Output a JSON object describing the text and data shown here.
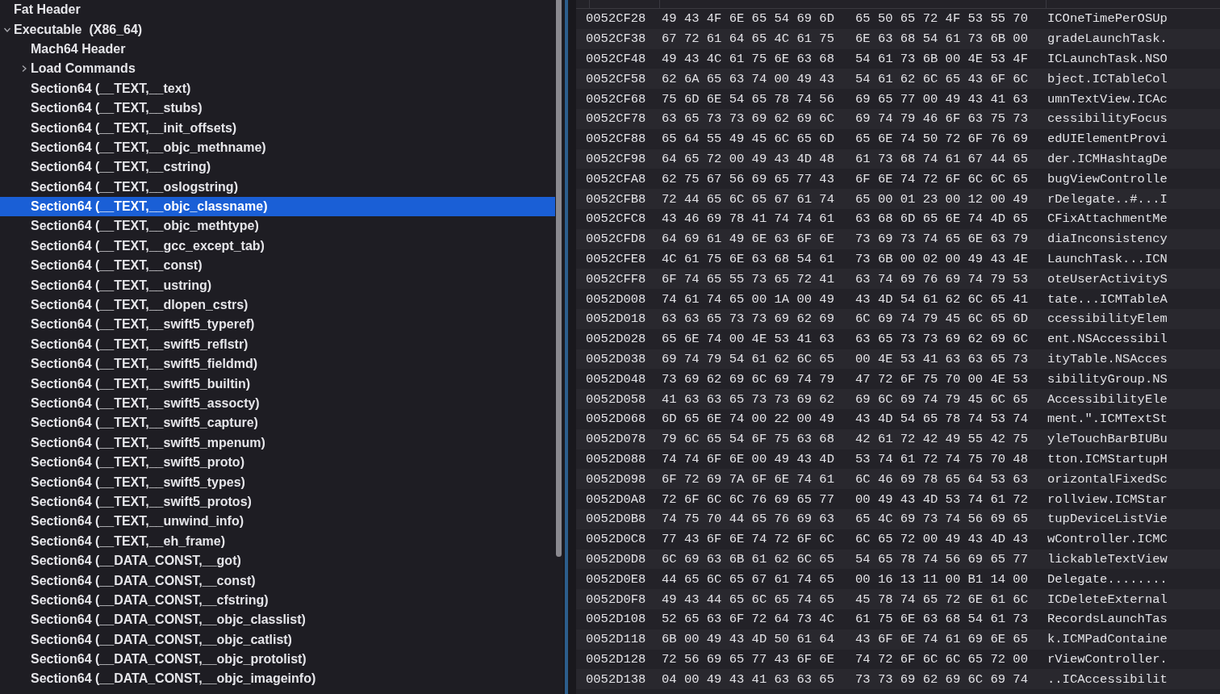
{
  "tree": [
    {
      "label": "Fat Header",
      "selected": false
    },
    {
      "label": "Executable  (X86_64)",
      "expanded": true,
      "selected": false,
      "children": [
        {
          "label": "Mach64 Header",
          "selected": false
        },
        {
          "label": "Load Commands",
          "expanded": false,
          "selected": false
        },
        {
          "label": "Section64 (__TEXT,__text)",
          "selected": false
        },
        {
          "label": "Section64 (__TEXT,__stubs)",
          "selected": false
        },
        {
          "label": "Section64 (__TEXT,__init_offsets)",
          "selected": false
        },
        {
          "label": "Section64 (__TEXT,__objc_methname)",
          "selected": false
        },
        {
          "label": "Section64 (__TEXT,__cstring)",
          "selected": false
        },
        {
          "label": "Section64 (__TEXT,__oslogstring)",
          "selected": false
        },
        {
          "label": "Section64 (__TEXT,__objc_classname)",
          "selected": true
        },
        {
          "label": "Section64 (__TEXT,__objc_methtype)",
          "selected": false
        },
        {
          "label": "Section64 (__TEXT,__gcc_except_tab)",
          "selected": false
        },
        {
          "label": "Section64 (__TEXT,__const)",
          "selected": false
        },
        {
          "label": "Section64 (__TEXT,__ustring)",
          "selected": false
        },
        {
          "label": "Section64 (__TEXT,__dlopen_cstrs)",
          "selected": false
        },
        {
          "label": "Section64 (__TEXT,__swift5_typeref)",
          "selected": false
        },
        {
          "label": "Section64 (__TEXT,__swift5_reflstr)",
          "selected": false
        },
        {
          "label": "Section64 (__TEXT,__swift5_fieldmd)",
          "selected": false
        },
        {
          "label": "Section64 (__TEXT,__swift5_builtin)",
          "selected": false
        },
        {
          "label": "Section64 (__TEXT,__swift5_assocty)",
          "selected": false
        },
        {
          "label": "Section64 (__TEXT,__swift5_capture)",
          "selected": false
        },
        {
          "label": "Section64 (__TEXT,__swift5_mpenum)",
          "selected": false
        },
        {
          "label": "Section64 (__TEXT,__swift5_proto)",
          "selected": false
        },
        {
          "label": "Section64 (__TEXT,__swift5_types)",
          "selected": false
        },
        {
          "label": "Section64 (__TEXT,__swift5_protos)",
          "selected": false
        },
        {
          "label": "Section64 (__TEXT,__unwind_info)",
          "selected": false
        },
        {
          "label": "Section64 (__TEXT,__eh_frame)",
          "selected": false
        },
        {
          "label": "Section64 (__DATA_CONST,__got)",
          "selected": false
        },
        {
          "label": "Section64 (__DATA_CONST,__const)",
          "selected": false
        },
        {
          "label": "Section64 (__DATA_CONST,__cfstring)",
          "selected": false
        },
        {
          "label": "Section64 (__DATA_CONST,__objc_classlist)",
          "selected": false
        },
        {
          "label": "Section64 (__DATA_CONST,__objc_catlist)",
          "selected": false
        },
        {
          "label": "Section64 (__DATA_CONST,__objc_protolist)",
          "selected": false
        },
        {
          "label": "Section64 (__DATA_CONST,__objc_imageinfo)",
          "selected": false
        }
      ]
    }
  ],
  "hex_rows": [
    {
      "address": "0052CF28",
      "bytes": [
        "49 43 4F 6E 65 54 69 6D",
        "65 50 65 72 4F 53 55 70"
      ],
      "ascii": "ICOneTimePerOSUp"
    },
    {
      "address": "0052CF38",
      "bytes": [
        "67 72 61 64 65 4C 61 75",
        "6E 63 68 54 61 73 6B 00"
      ],
      "ascii": "gradeLaunchTask."
    },
    {
      "address": "0052CF48",
      "bytes": [
        "49 43 4C 61 75 6E 63 68",
        "54 61 73 6B 00 4E 53 4F"
      ],
      "ascii": "ICLaunchTask.NSO"
    },
    {
      "address": "0052CF58",
      "bytes": [
        "62 6A 65 63 74 00 49 43",
        "54 61 62 6C 65 43 6F 6C"
      ],
      "ascii": "bject.ICTableCol"
    },
    {
      "address": "0052CF68",
      "bytes": [
        "75 6D 6E 54 65 78 74 56",
        "69 65 77 00 49 43 41 63"
      ],
      "ascii": "umnTextView.ICAc"
    },
    {
      "address": "0052CF78",
      "bytes": [
        "63 65 73 73 69 62 69 6C",
        "69 74 79 46 6F 63 75 73"
      ],
      "ascii": "cessibilityFocus"
    },
    {
      "address": "0052CF88",
      "bytes": [
        "65 64 55 49 45 6C 65 6D",
        "65 6E 74 50 72 6F 76 69"
      ],
      "ascii": "edUIElementProvi"
    },
    {
      "address": "0052CF98",
      "bytes": [
        "64 65 72 00 49 43 4D 48",
        "61 73 68 74 61 67 44 65"
      ],
      "ascii": "der.ICMHashtagDe"
    },
    {
      "address": "0052CFA8",
      "bytes": [
        "62 75 67 56 69 65 77 43",
        "6F 6E 74 72 6F 6C 6C 65"
      ],
      "ascii": "bugViewControlle"
    },
    {
      "address": "0052CFB8",
      "bytes": [
        "72 44 65 6C 65 67 61 74",
        "65 00 01 23 00 12 00 49"
      ],
      "ascii": "rDelegate..#...I"
    },
    {
      "address": "0052CFC8",
      "bytes": [
        "43 46 69 78 41 74 74 61",
        "63 68 6D 65 6E 74 4D 65"
      ],
      "ascii": "CFixAttachmentMe"
    },
    {
      "address": "0052CFD8",
      "bytes": [
        "64 69 61 49 6E 63 6F 6E",
        "73 69 73 74 65 6E 63 79"
      ],
      "ascii": "diaInconsistency"
    },
    {
      "address": "0052CFE8",
      "bytes": [
        "4C 61 75 6E 63 68 54 61",
        "73 6B 00 02 00 49 43 4E"
      ],
      "ascii": "LaunchTask...ICN"
    },
    {
      "address": "0052CFF8",
      "bytes": [
        "6F 74 65 55 73 65 72 41",
        "63 74 69 76 69 74 79 53"
      ],
      "ascii": "oteUserActivityS"
    },
    {
      "address": "0052D008",
      "bytes": [
        "74 61 74 65 00 1A 00 49",
        "43 4D 54 61 62 6C 65 41"
      ],
      "ascii": "tate...ICMTableA"
    },
    {
      "address": "0052D018",
      "bytes": [
        "63 63 65 73 73 69 62 69",
        "6C 69 74 79 45 6C 65 6D"
      ],
      "ascii": "ccessibilityElem"
    },
    {
      "address": "0052D028",
      "bytes": [
        "65 6E 74 00 4E 53 41 63",
        "63 65 73 73 69 62 69 6C"
      ],
      "ascii": "ent.NSAccessibil"
    },
    {
      "address": "0052D038",
      "bytes": [
        "69 74 79 54 61 62 6C 65",
        "00 4E 53 41 63 63 65 73"
      ],
      "ascii": "ityTable.NSAcces"
    },
    {
      "address": "0052D048",
      "bytes": [
        "73 69 62 69 6C 69 74 79",
        "47 72 6F 75 70 00 4E 53"
      ],
      "ascii": "sibilityGroup.NS"
    },
    {
      "address": "0052D058",
      "bytes": [
        "41 63 63 65 73 73 69 62",
        "69 6C 69 74 79 45 6C 65"
      ],
      "ascii": "AccessibilityEle"
    },
    {
      "address": "0052D068",
      "bytes": [
        "6D 65 6E 74 00 22 00 49",
        "43 4D 54 65 78 74 53 74"
      ],
      "ascii": "ment.\".ICMTextSt"
    },
    {
      "address": "0052D078",
      "bytes": [
        "79 6C 65 54 6F 75 63 68",
        "42 61 72 42 49 55 42 75"
      ],
      "ascii": "yleTouchBarBIUBu"
    },
    {
      "address": "0052D088",
      "bytes": [
        "74 74 6F 6E 00 49 43 4D",
        "53 74 61 72 74 75 70 48"
      ],
      "ascii": "tton.ICMStartupH"
    },
    {
      "address": "0052D098",
      "bytes": [
        "6F 72 69 7A 6F 6E 74 61",
        "6C 46 69 78 65 64 53 63"
      ],
      "ascii": "orizontalFixedSc"
    },
    {
      "address": "0052D0A8",
      "bytes": [
        "72 6F 6C 6C 76 69 65 77",
        "00 49 43 4D 53 74 61 72"
      ],
      "ascii": "rollview.ICMStar"
    },
    {
      "address": "0052D0B8",
      "bytes": [
        "74 75 70 44 65 76 69 63",
        "65 4C 69 73 74 56 69 65"
      ],
      "ascii": "tupDeviceListVie"
    },
    {
      "address": "0052D0C8",
      "bytes": [
        "77 43 6F 6E 74 72 6F 6C",
        "6C 65 72 00 49 43 4D 43"
      ],
      "ascii": "wController.ICMC"
    },
    {
      "address": "0052D0D8",
      "bytes": [
        "6C 69 63 6B 61 62 6C 65",
        "54 65 78 74 56 69 65 77"
      ],
      "ascii": "lickableTextView"
    },
    {
      "address": "0052D0E8",
      "bytes": [
        "44 65 6C 65 67 61 74 65",
        "00 16 13 11 00 B1 14 00"
      ],
      "ascii": "Delegate........"
    },
    {
      "address": "0052D0F8",
      "bytes": [
        "49 43 44 65 6C 65 74 65",
        "45 78 74 65 72 6E 61 6C"
      ],
      "ascii": "ICDeleteExternal"
    },
    {
      "address": "0052D108",
      "bytes": [
        "52 65 63 6F 72 64 73 4C",
        "61 75 6E 63 68 54 61 73"
      ],
      "ascii": "RecordsLaunchTas"
    },
    {
      "address": "0052D118",
      "bytes": [
        "6B 00 49 43 4D 50 61 64",
        "43 6F 6E 74 61 69 6E 65"
      ],
      "ascii": "k.ICMPadContaine"
    },
    {
      "address": "0052D128",
      "bytes": [
        "72 56 69 65 77 43 6F 6E",
        "74 72 6F 6C 6C 65 72 00"
      ],
      "ascii": "rViewController."
    },
    {
      "address": "0052D138",
      "bytes": [
        "04 00 49 43 41 63 63 65",
        "73 73 69 62 69 6C 69 74"
      ],
      "ascii": "..ICAccessibilit"
    }
  ]
}
